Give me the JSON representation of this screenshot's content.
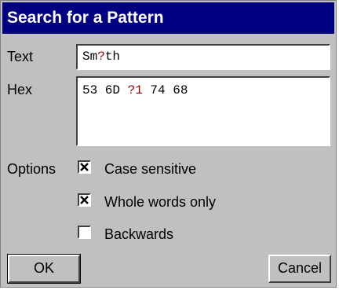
{
  "dialog": {
    "title": "Search for a Pattern",
    "text_label": "Text",
    "text_value_part1": "Sm",
    "text_value_wild": "?",
    "text_value_part2": "th",
    "hex_label": "Hex",
    "hex_value_part1": "53 6D ",
    "hex_value_wild": "?1",
    "hex_value_part2": " 74 68",
    "options_label": "Options",
    "options": {
      "case_sensitive": {
        "label": "Case sensitive",
        "checked": true
      },
      "whole_words": {
        "label": "Whole words only",
        "checked": true
      },
      "backwards": {
        "label": "Backwards",
        "checked": false
      }
    },
    "ok_label": "OK",
    "cancel_label": "Cancel"
  },
  "colors": {
    "title_bg": "#000080",
    "face": "#c0c0c0",
    "wildcard": "#a00000"
  }
}
